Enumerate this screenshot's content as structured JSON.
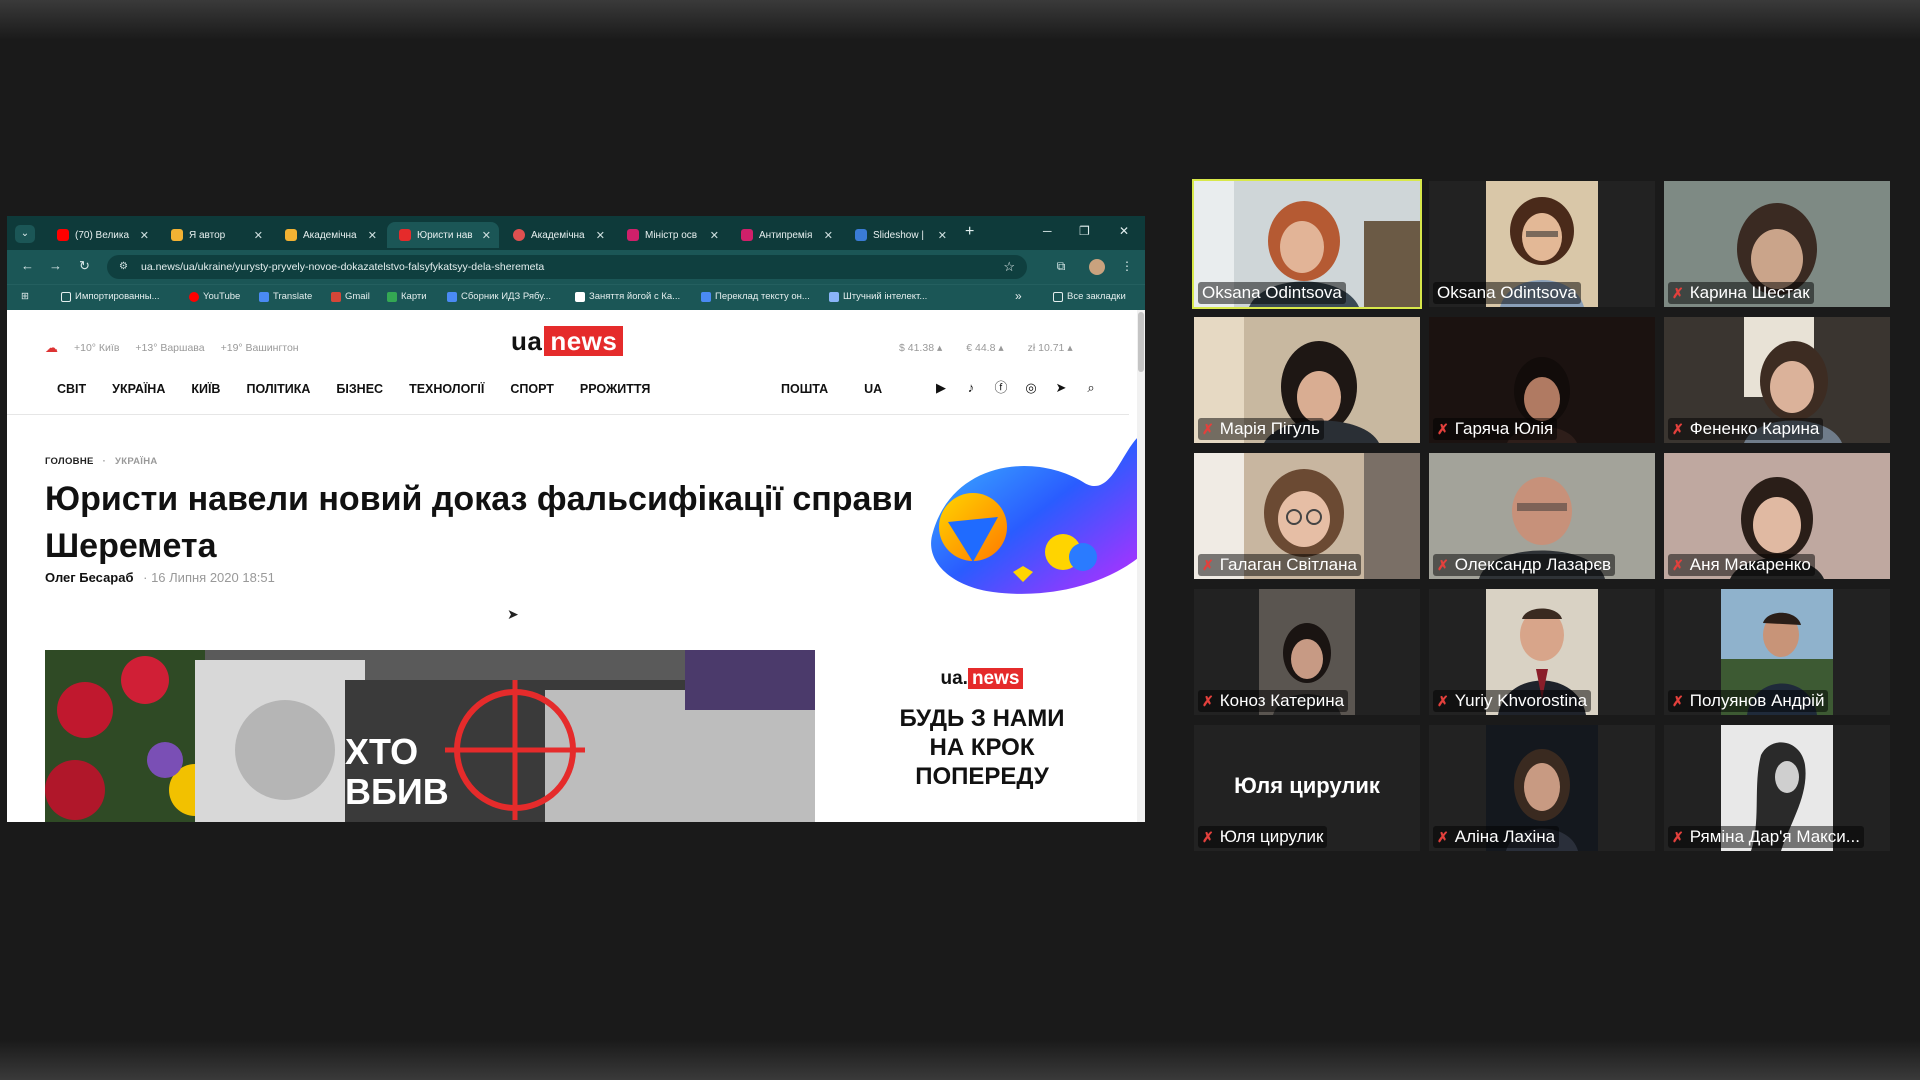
{
  "browser": {
    "tabs": [
      {
        "label": "(70) Велика",
        "color": "#ff0000"
      },
      {
        "label": "Я автор",
        "color": "#f2b233"
      },
      {
        "label": "Академічна",
        "color": "#f2b233"
      },
      {
        "label": "Юристи нав",
        "color": "#e52b2b"
      },
      {
        "label": "Академічна",
        "color": "#e05050"
      },
      {
        "label": "Міністр осв",
        "color": "#d0206a"
      },
      {
        "label": "Антипремія",
        "color": "#d0206a"
      },
      {
        "label": "Slideshow |",
        "color": "#3a7bd5"
      }
    ],
    "new_tab": "+",
    "url": "ua.news/ua/ukraine/yurysty-pryvely-novoe-dokazatelstvo-falsyfykatsyy-dela-sheremeta",
    "bookmarks": [
      "Импортированны...",
      "YouTube",
      "Translate",
      "Gmail",
      "Карти",
      "Сборник ИДЗ Рябу...",
      "Заняття йогой с Ка...",
      "Переклад тексту он...",
      "Штучний інтелект..."
    ],
    "more_bookmarks": "»",
    "all_bookmarks": "Все закладки"
  },
  "site": {
    "weather": [
      "+10° Київ",
      "+13° Варшава",
      "+19° Вашингтон"
    ],
    "logo_left": "ua",
    "logo_right": "news",
    "rates": [
      "$ 41.38 ▴",
      "€ 44.8 ▴",
      "zł 10.71 ▴"
    ],
    "nav": [
      "СВІТ",
      "УКРАЇНА",
      "КИЇВ",
      "ПОЛІТИКА",
      "БІЗНЕС",
      "ТЕХНОЛОГІЇ",
      "СПОРТ",
      "РРОЖИТТЯ"
    ],
    "nav_right": [
      "ПОШТА",
      "UA"
    ],
    "breadcrumb_1": "ГОЛОВНЕ",
    "breadcrumb_sep": "·",
    "breadcrumb_2": "УКРАЇНА",
    "headline": "Юристи навели новий доказ фальсифікації справи Шеремета",
    "author": "Олег Бесараб",
    "date": "· 16 Липня 2020 18:51",
    "photo_text_1": "ХТО",
    "photo_text_2": "ВБИВ",
    "ad_logo_left": "ua.",
    "ad_logo_right": "news",
    "ad_line_1": "БУДЬ З НАМИ",
    "ad_line_2": "НА КРОК",
    "ad_line_3": "ПОПЕРЕДУ"
  },
  "participants": [
    {
      "name": "Oksana Odintsova",
      "muted": false,
      "speaking": true
    },
    {
      "name": "Oksana Odintsova",
      "muted": false,
      "speaking": false
    },
    {
      "name": "Карина Шестак",
      "muted": true,
      "speaking": false
    },
    {
      "name": "Марія Пігуль",
      "muted": true,
      "speaking": false
    },
    {
      "name": "Гаряча Юлія",
      "muted": true,
      "speaking": false
    },
    {
      "name": "Фененко Карина",
      "muted": true,
      "speaking": false
    },
    {
      "name": "Галаган Світлана",
      "muted": true,
      "speaking": false
    },
    {
      "name": "Олександр Лазарєв",
      "muted": true,
      "speaking": false
    },
    {
      "name": "Аня Макаренко",
      "muted": true,
      "speaking": false
    },
    {
      "name": "Коноз Катерина",
      "muted": true,
      "speaking": false
    },
    {
      "name": "Yuriy Khvorostina",
      "muted": true,
      "speaking": false
    },
    {
      "name": "Полуянов Андрій",
      "muted": true,
      "speaking": false
    },
    {
      "name": "Юля цирулик",
      "muted": true,
      "speaking": false,
      "video_off_label": "Юля цирулик"
    },
    {
      "name": "Аліна Лахіна",
      "muted": true,
      "speaking": false
    },
    {
      "name": "Ряміна Дар'я Макси...",
      "muted": true,
      "speaking": false
    }
  ],
  "colors": {
    "speaker_border": "#d8e84a",
    "mute_icon": "#e3403c",
    "browser_frame": "#1b5656",
    "brand_red": "#e52b2b"
  }
}
